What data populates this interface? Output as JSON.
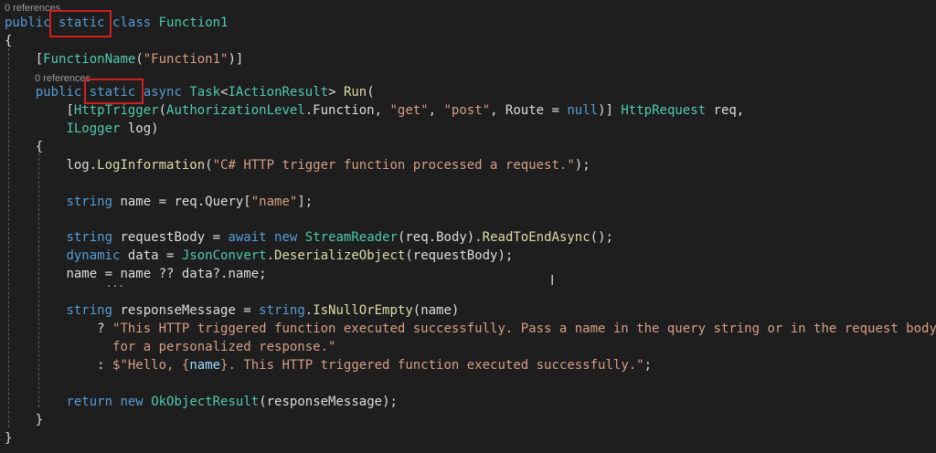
{
  "colors": {
    "background": "#1e1e1e",
    "keyword": "#569cd6",
    "type": "#4ec9b0",
    "method": "#dcdcaa",
    "string": "#d69d85",
    "variable": "#9cdcfe",
    "plain": "#dcdcdc",
    "highlight_box": "#d11f1f",
    "codelens": "#999999"
  },
  "codelens": [
    "0 references",
    "0 references"
  ],
  "tokens": {
    "public": "public",
    "static": "static",
    "class": "class",
    "class_name": "Function1",
    "brace_open": "{",
    "brace_close": "}",
    "attr_open": "[",
    "FunctionName": "FunctionName",
    "attr_fn_arg": "(\"Function1\")",
    "attr_close": "]",
    "async": "async",
    "Task": "Task",
    "lt": "<",
    "IActionResult": "IActionResult",
    "gt_run": ">",
    "Run": "Run",
    "paren_open": "(",
    "HttpTrigger": "HttpTrigger",
    "AuthorizationLevel": "AuthorizationLevel",
    "dot_Function": ".Function, ",
    "get_str": "\"get\"",
    "comma_sp": ", ",
    "post_str": "\"post\"",
    "route_part": ", Route = ",
    "null": "null",
    "close_attr_paren": ")] ",
    "HttpRequest": "HttpRequest",
    "req_param": " req,",
    "ILogger": "ILogger",
    "log_param": " log)",
    "log_call_a": "log.",
    "LogInformation": "LogInformation",
    "log_str": "\"C# HTTP trigger function processed a request.\"",
    "log_end": ");",
    "string": "string",
    "name_decl": " name = req.Query[",
    "name_str": "\"name\"",
    "name_end": "];",
    "requestBody_decl": " requestBody = ",
    "await": "await",
    "new": "new",
    "StreamReader": "StreamReader",
    "sr_args": "(req.Body).",
    "ReadToEndAsync": "ReadToEndAsync",
    "call_end": "();",
    "dynamic": "dynamic",
    "data_decl": " data = ",
    "JsonConvert": "JsonConvert",
    "dot": ".",
    "DeserializeObject": "DeserializeObject",
    "deser_args": "(requestBody);",
    "name_assign": "name = name ?? data?.name;",
    "responseMessage_decl": " responseMessage = ",
    "IsNullOrEmpty": "IsNullOrEmpty",
    "isnull_args": "(name)",
    "q_prefix": "? ",
    "msg_str_1": "\"This HTTP triggered function executed successfully. Pass a name in the query string or in the request body",
    "msg_str_2": "for a personalized response.\"",
    "colon_prefix": ": ",
    "interp_start": "$\"Hello, {",
    "interp_name": "name",
    "interp_end": "}. This HTTP triggered function executed successfully.\"",
    "semicolon": ";",
    "return": "return",
    "OkObjectResult": "OkObjectResult",
    "ok_args": "(responseMessage);"
  }
}
